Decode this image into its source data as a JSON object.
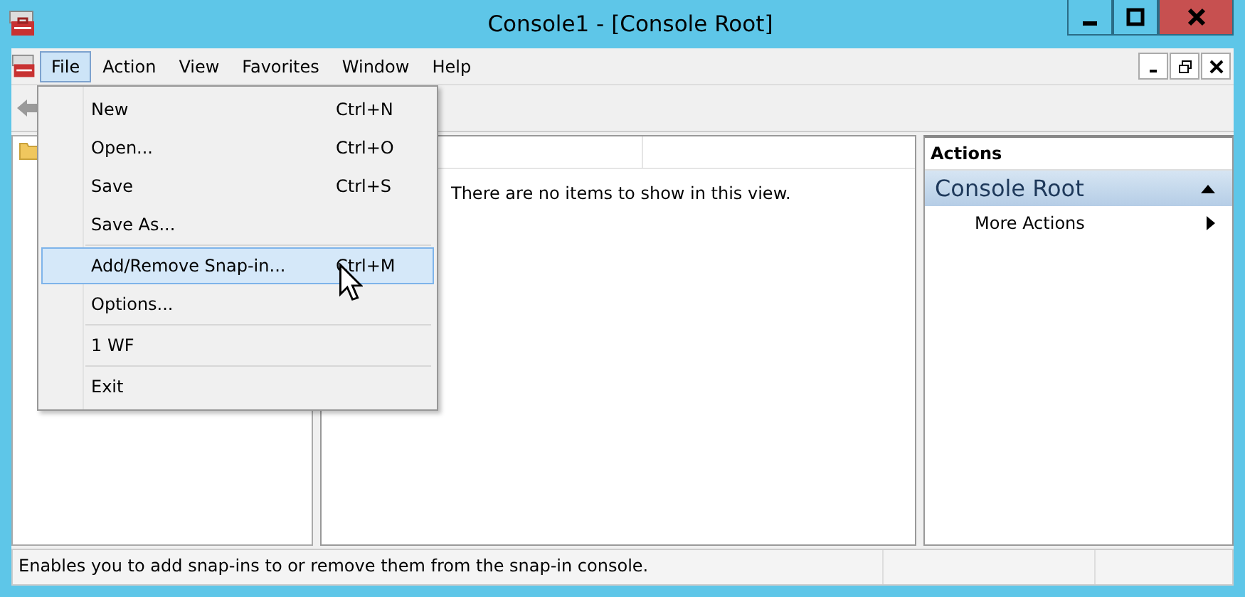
{
  "window": {
    "title": "Console1 - [Console Root]"
  },
  "menu_bar": [
    {
      "label": "File",
      "selected": true
    },
    {
      "label": "Action",
      "selected": false
    },
    {
      "label": "View",
      "selected": false
    },
    {
      "label": "Favorites",
      "selected": false
    },
    {
      "label": "Window",
      "selected": false
    },
    {
      "label": "Help",
      "selected": false
    }
  ],
  "file_menu": {
    "groups": [
      [
        {
          "label": "New",
          "shortcut": "Ctrl+N",
          "selected": false
        },
        {
          "label": "Open...",
          "shortcut": "Ctrl+O",
          "selected": false
        },
        {
          "label": "Save",
          "shortcut": "Ctrl+S",
          "selected": false
        },
        {
          "label": "Save As...",
          "selected": false
        }
      ],
      [
        {
          "label": "Add/Remove Snap-in...",
          "shortcut": "Ctrl+M",
          "selected": true
        },
        {
          "label": "Options...",
          "selected": false
        }
      ],
      [
        {
          "label": "1 WF",
          "selected": false
        }
      ],
      [
        {
          "label": "Exit",
          "selected": false
        }
      ]
    ]
  },
  "results_pane": {
    "message": "There are no items to show in this view."
  },
  "actions_pane": {
    "title": "Actions",
    "section": {
      "label": "Console Root",
      "expanded": true
    },
    "items": [
      {
        "label": "More Actions",
        "has_submenu": true
      }
    ]
  },
  "status_bar": {
    "text": "Enables you to add snap-ins to or remove them from the snap-in console."
  }
}
